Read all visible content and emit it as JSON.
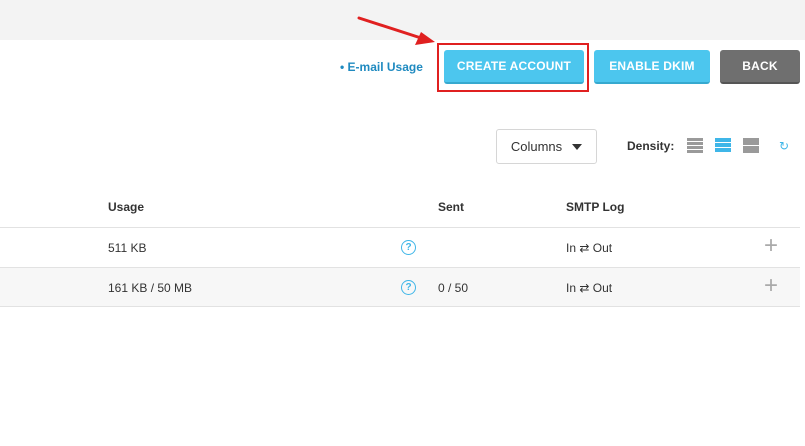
{
  "toolbar": {
    "email_usage_link": "• E-mail Usage",
    "create_account": "CREATE ACCOUNT",
    "enable_dkim": "ENABLE DKIM",
    "back": "BACK"
  },
  "controls": {
    "columns_label": "Columns",
    "density_label": "Density:",
    "refresh_glyph": "↻"
  },
  "table": {
    "headers": {
      "usage": "Usage",
      "sent": "Sent",
      "smtp": "SMTP Log"
    },
    "rows": [
      {
        "usage": "511 KB",
        "help": "?",
        "sent": "",
        "smtp": "In ⇄ Out",
        "expand": "+"
      },
      {
        "usage": "161 KB / 50 MB",
        "help": "?",
        "sent": "0 / 50",
        "smtp": "In ⇄ Out",
        "expand": "+"
      }
    ]
  },
  "colors": {
    "accent_blue": "#4cc6ee",
    "link_blue": "#1f8ac0",
    "back_grey": "#6f6f6f",
    "highlight_red": "#e02020"
  }
}
